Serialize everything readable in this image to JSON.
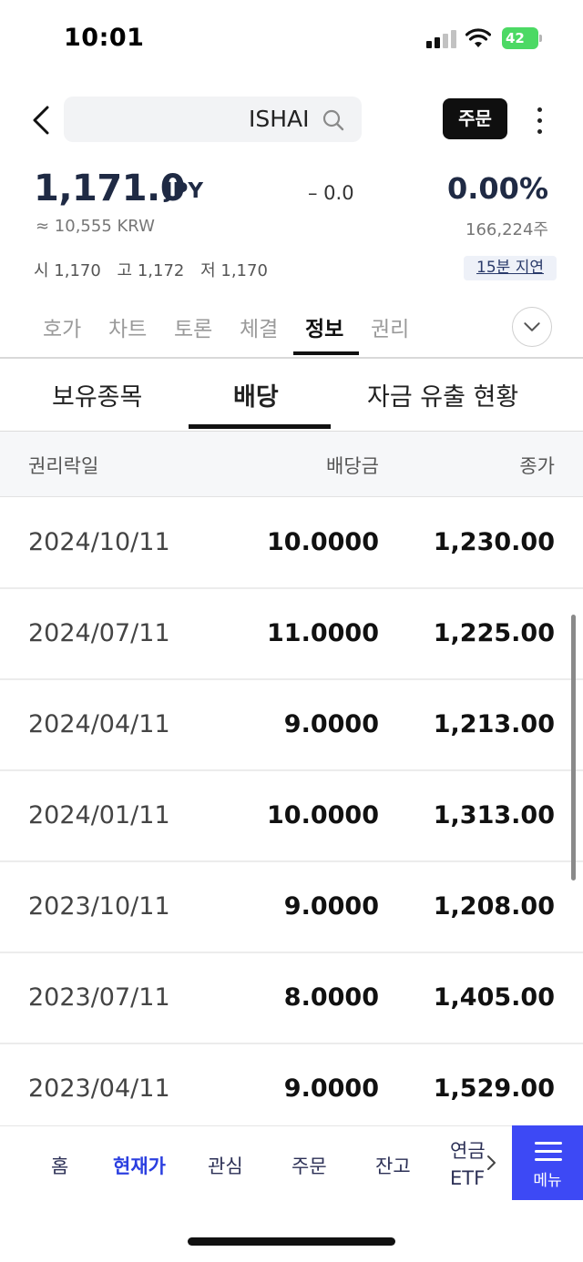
{
  "status_bar": {
    "time": "10:01",
    "battery": "42",
    "icons": [
      "signal-icon",
      "wifi-icon",
      "battery-icon"
    ]
  },
  "header": {
    "search_text": "ISHAI",
    "order_label": "주문",
    "icons": [
      "back-arrow-icon",
      "search-icon",
      "more-vertical-icon"
    ]
  },
  "quote": {
    "price": "1,171.0",
    "currency": "JPY",
    "change": "– 0.0",
    "change_pct": "0.00%",
    "krw": "≈ 10,555 KRW",
    "volume": "166,224주",
    "open": "시 1,170",
    "high": "고 1,172",
    "low": "저 1,170",
    "delay": "15분 지연"
  },
  "main_tabs": [
    {
      "label": "호가"
    },
    {
      "label": "차트"
    },
    {
      "label": "토론"
    },
    {
      "label": "체결"
    },
    {
      "label": "정보"
    },
    {
      "label": "권리"
    }
  ],
  "main_tabs_active": "정보",
  "sub_tabs": [
    {
      "label": "보유종목"
    },
    {
      "label": "배당"
    },
    {
      "label": "자금 유출 현황"
    }
  ],
  "sub_tabs_active": "배당",
  "table": {
    "columns": [
      "권리락일",
      "배당금",
      "종가"
    ],
    "rows": [
      {
        "date": "2024/10/11",
        "dividend": "10.0000",
        "close": "1,230.00"
      },
      {
        "date": "2024/07/11",
        "dividend": "11.0000",
        "close": "1,225.00"
      },
      {
        "date": "2024/04/11",
        "dividend": "9.0000",
        "close": "1,213.00"
      },
      {
        "date": "2024/01/11",
        "dividend": "10.0000",
        "close": "1,313.00"
      },
      {
        "date": "2023/10/11",
        "dividend": "9.0000",
        "close": "1,208.00"
      },
      {
        "date": "2023/07/11",
        "dividend": "8.0000",
        "close": "1,405.00"
      },
      {
        "date": "2023/04/11",
        "dividend": "9.0000",
        "close": "1,529.00"
      }
    ]
  },
  "bottom_nav": {
    "items": [
      {
        "label": "홈"
      },
      {
        "label": "현재가"
      },
      {
        "label": "관심"
      },
      {
        "label": "주문"
      },
      {
        "label": "잔고"
      }
    ],
    "active": "현재가",
    "more_label_1": "연금",
    "more_label_2": "ETF",
    "menu_label": "메뉴"
  },
  "colors": {
    "accent": "#3d49f5",
    "active_nav": "#2b3fe0",
    "price_text": "#1f2a44"
  }
}
